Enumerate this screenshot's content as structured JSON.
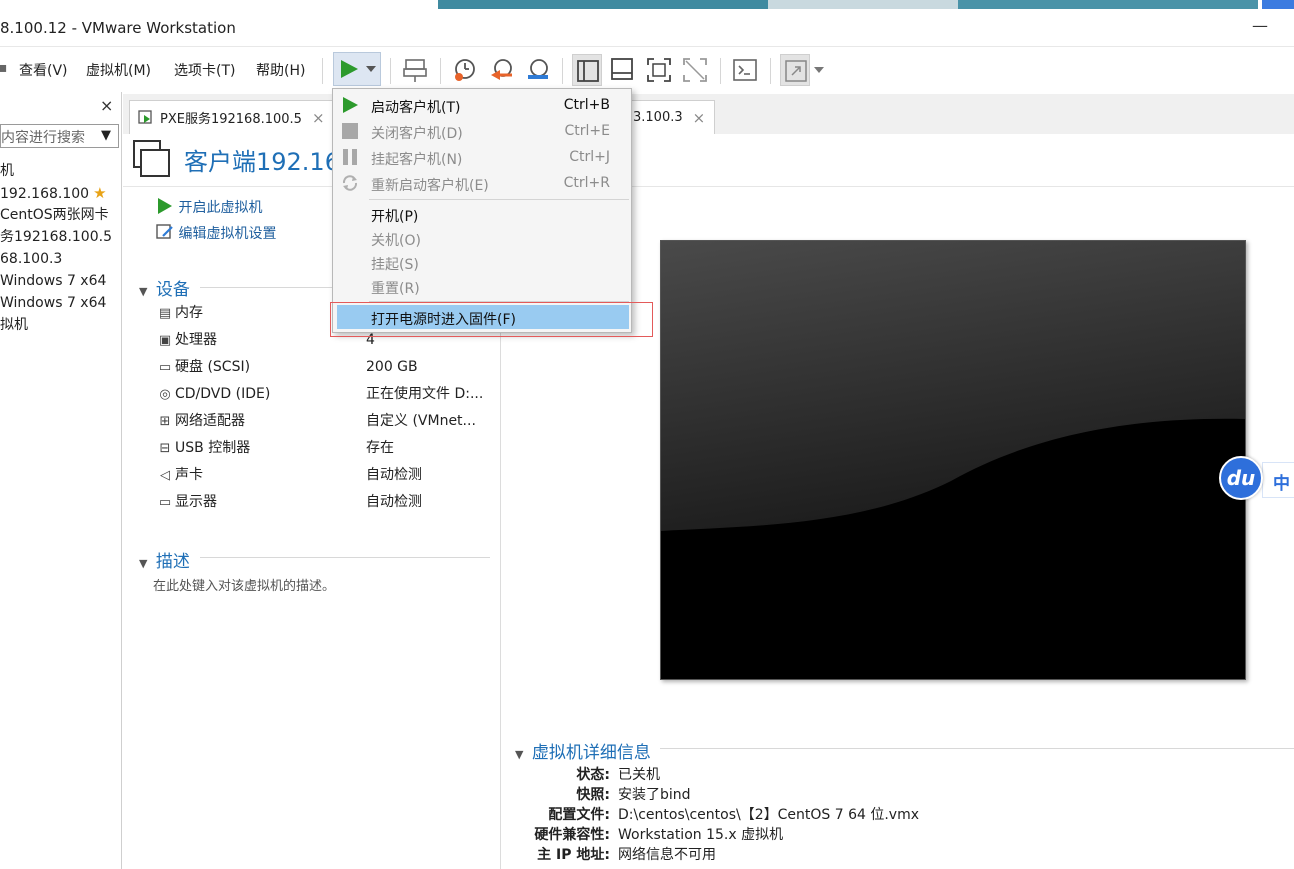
{
  "window": {
    "title": "8.100.12 - VMware Workstation",
    "minimize": "—"
  },
  "menubar": {
    "items": [
      "查看(V)",
      "虚拟机(M)",
      "选项卡(T)",
      "帮助(H)"
    ]
  },
  "library": {
    "close": "×",
    "search_placeholder": "内容进行搜索",
    "items": [
      "机",
      "192.168.100",
      "CentOS两张网卡",
      "务192168.100.5",
      "68.100.3",
      "Windows 7 x64",
      "Windows 7 x64",
      "拟机"
    ],
    "favorite_icon": "star-icon"
  },
  "tabs": [
    {
      "label": "PXE服务192168.100.5",
      "close": "×"
    },
    {
      "label": "3.100.3",
      "close": "×"
    }
  ],
  "vm": {
    "title": "客户端192.16",
    "actions": {
      "power_on": "开启此虚拟机",
      "edit_settings": "编辑虚拟机设置"
    },
    "devices_heading": "设备",
    "devices": [
      {
        "icon": "memory-icon",
        "name": "内存",
        "value": ""
      },
      {
        "icon": "cpu-icon",
        "name": "处理器",
        "value": "4"
      },
      {
        "icon": "disk-icon",
        "name": "硬盘 (SCSI)",
        "value": "200 GB"
      },
      {
        "icon": "cd-icon",
        "name": "CD/DVD (IDE)",
        "value": "正在使用文件 D:..."
      },
      {
        "icon": "network-icon",
        "name": "网络适配器",
        "value": "自定义 (VMnet..."
      },
      {
        "icon": "usb-icon",
        "name": "USB 控制器",
        "value": "存在"
      },
      {
        "icon": "sound-icon",
        "name": "声卡",
        "value": "自动检测"
      },
      {
        "icon": "display-icon",
        "name": "显示器",
        "value": "自动检测"
      }
    ],
    "description_heading": "描述",
    "description_placeholder": "在此处键入对该虚拟机的描述。"
  },
  "details": {
    "heading": "虚拟机详细信息",
    "rows": [
      {
        "label": "状态:",
        "value": "已关机"
      },
      {
        "label": "快照:",
        "value": "安装了bind"
      },
      {
        "label": "配置文件:",
        "value": "D:\\centos\\centos\\【2】CentOS 7 64 位.vmx"
      },
      {
        "label": "硬件兼容性:",
        "value": "Workstation 15.x 虚拟机"
      },
      {
        "label": "主 IP 地址:",
        "value": "网络信息不可用"
      }
    ]
  },
  "power_menu": {
    "items": [
      {
        "label": "启动客户机(T)",
        "shortcut": "Ctrl+B",
        "enabled": true,
        "icon": "play-icon"
      },
      {
        "label": "关闭客户机(D)",
        "shortcut": "Ctrl+E",
        "enabled": false,
        "icon": "stop-icon"
      },
      {
        "label": "挂起客户机(N)",
        "shortcut": "Ctrl+J",
        "enabled": false,
        "icon": "pause-icon"
      },
      {
        "label": "重新启动客户机(E)",
        "shortcut": "Ctrl+R",
        "enabled": false,
        "icon": "restart-icon"
      },
      {
        "label": "开机(P)",
        "shortcut": "",
        "enabled": true
      },
      {
        "label": "关机(O)",
        "shortcut": "",
        "enabled": false
      },
      {
        "label": "挂起(S)",
        "shortcut": "",
        "enabled": false
      },
      {
        "label": "重置(R)",
        "shortcut": "",
        "enabled": false
      },
      {
        "label": "打开电源时进入固件(F)",
        "shortcut": "",
        "enabled": true,
        "highlighted": true
      }
    ]
  },
  "baidu": {
    "logo": "du",
    "tag": "中"
  },
  "colors": {
    "accent": "#1f6fb6",
    "menu_highlight": "#99cbf1",
    "annotation_box": "#e35a5a",
    "play_green": "#2c9a2c"
  }
}
